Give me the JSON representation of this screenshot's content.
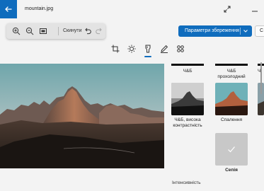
{
  "window": {
    "file_name": "mountain.jpg"
  },
  "toolbar": {
    "reset_label": "Скинути"
  },
  "actions": {
    "save_options_label": "Параметри збереження",
    "other_label": "С"
  },
  "edit_tools": [
    "crop-icon",
    "brightness-icon",
    "filter-icon",
    "markup-icon",
    "more-icon"
  ],
  "filters": {
    "top_row": [
      {
        "label": "Ч&Б"
      },
      {
        "label": "Ч&Б\nпрохолодний"
      },
      {
        "label": "Ч"
      }
    ],
    "mid_row": [
      {
        "label": "Ч&Б, висока\nконтрастність"
      },
      {
        "label": "Спалення"
      }
    ],
    "selected": {
      "label": "Сепія"
    }
  },
  "intensity_label": "Інтенсивність",
  "colors": {
    "accent": "#0f6cbd",
    "background": "#f3f3f3"
  }
}
